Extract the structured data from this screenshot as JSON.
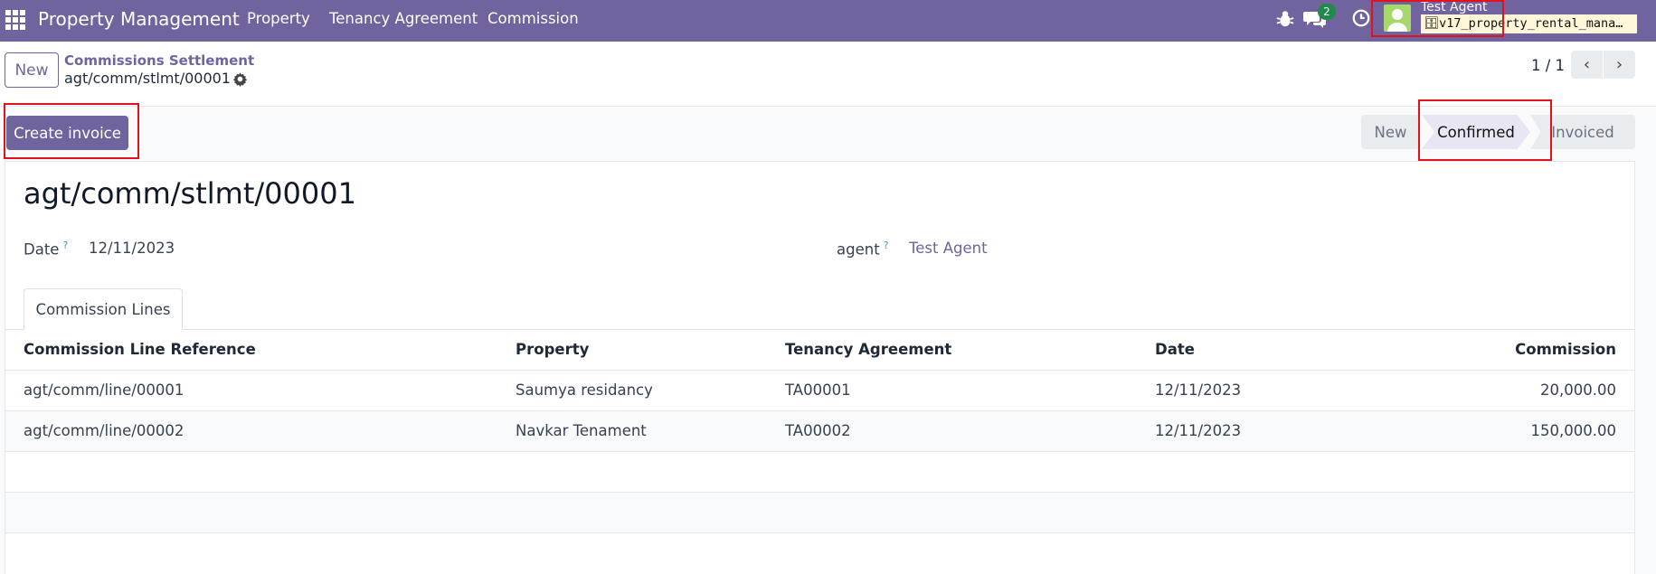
{
  "navbar": {
    "brand": "Property Management",
    "menu": [
      "Property",
      "Tenancy Agreement",
      "Commission"
    ],
    "messages_badge": "2",
    "user_name": "Test Agent",
    "database": "v17_property_rental_mana…",
    "icons": [
      "apps-icon",
      "bug-icon",
      "chat-icon",
      "clock-icon",
      "avatar"
    ]
  },
  "control_panel": {
    "new_label": "New",
    "breadcrumb_parent": "Commissions Settlement",
    "breadcrumb_current": "agt/comm/stlmt/00001",
    "pager": "1 / 1"
  },
  "status_bar": {
    "create_invoice_label": "Create invoice",
    "stages": [
      "New",
      "Confirmed",
      "Invoiced"
    ],
    "current_stage": "Confirmed"
  },
  "form": {
    "title": "agt/comm/stlmt/00001",
    "date_label": "Date",
    "date_value": "12/11/2023",
    "agent_label": "agent",
    "agent_value": "Test Agent",
    "help_mark": "?"
  },
  "tab": {
    "label": "Commission Lines"
  },
  "table": {
    "columns": [
      "Commission Line Reference",
      "Property",
      "Tenancy Agreement",
      "Date",
      "Commission"
    ],
    "rows": [
      [
        "agt/comm/line/00001",
        "Saumya residancy",
        "TA00001",
        "12/11/2023",
        "20,000.00"
      ],
      [
        "agt/comm/line/00002",
        "Navkar Tenament",
        "TA00002",
        "12/11/2023",
        "150,000.00"
      ]
    ]
  },
  "colors": {
    "brand": "#71639e",
    "highlight": "#e0121c",
    "badge": "#1f8a4c"
  }
}
